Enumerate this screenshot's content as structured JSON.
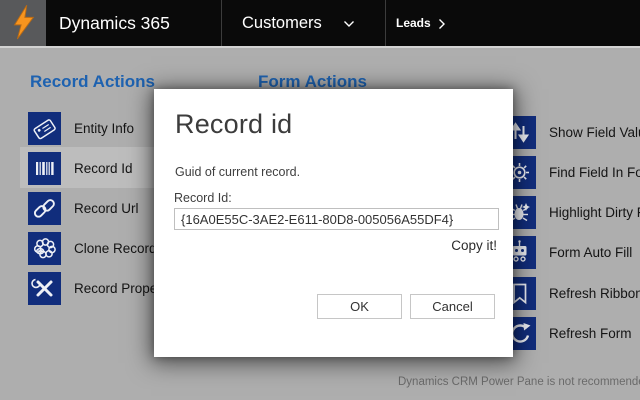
{
  "header": {
    "app_title": "Dynamics 365",
    "nav_entity": "Customers",
    "breadcrumb": "Leads"
  },
  "panel": {
    "record_actions_title": "Record Actions",
    "form_actions_title": "Form Actions",
    "record_actions": [
      {
        "label": "Entity Info",
        "icon": "tag-icon"
      },
      {
        "label": "Record Id",
        "icon": "barcode-icon",
        "active": true
      },
      {
        "label": "Record Url",
        "icon": "link-icon"
      },
      {
        "label": "Clone Record",
        "icon": "sheep-icon"
      },
      {
        "label": "Record Properties",
        "icon": "tools-icon"
      }
    ],
    "form_actions": [
      {
        "label": "Show Field Value",
        "icon": "sort-arrows-icon"
      },
      {
        "label": "Find Field In Form",
        "icon": "gear-icon"
      },
      {
        "label": "Highlight Dirty Fields",
        "icon": "bug-icon"
      },
      {
        "label": "Form Auto Fill",
        "icon": "robot-icon"
      },
      {
        "label": "Refresh Ribbon",
        "icon": "bookmark-icon"
      },
      {
        "label": "Refresh Form",
        "icon": "refresh-icon"
      }
    ]
  },
  "dialog": {
    "title": "Record id",
    "description": "Guid of current record.",
    "field_label": "Record Id:",
    "field_value": "{16A0E55C-3AE2-E611-80D8-005056A55DF4}",
    "copy_link": "Copy it!",
    "ok_label": "OK",
    "cancel_label": "Cancel"
  },
  "status_bar": {
    "message": "Dynamics CRM Power Pane is not recommended f"
  },
  "colors": {
    "header_bg": "#0a0a0a",
    "overlay_gray": "#aeaeae",
    "tile_navy": "#112d7c",
    "accent_blue": "#1e62b0",
    "bolt_orange": "#f7941e"
  }
}
